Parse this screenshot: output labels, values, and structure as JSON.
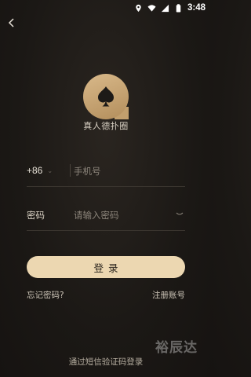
{
  "status_bar": {
    "time": "3:48"
  },
  "app": {
    "name": "真人德扑圈",
    "accent_color": "#ecd7b1",
    "logo_color": "#c9a672"
  },
  "phone": {
    "country_code": "+86",
    "placeholder": "手机号"
  },
  "password": {
    "label": "密码",
    "placeholder": "请输入密码"
  },
  "actions": {
    "login_label": "登录",
    "forgot_label": "忘记密码?",
    "register_label": "注册账号",
    "sms_login_label": "通过短信验证码登录"
  },
  "watermark": "裕辰达"
}
